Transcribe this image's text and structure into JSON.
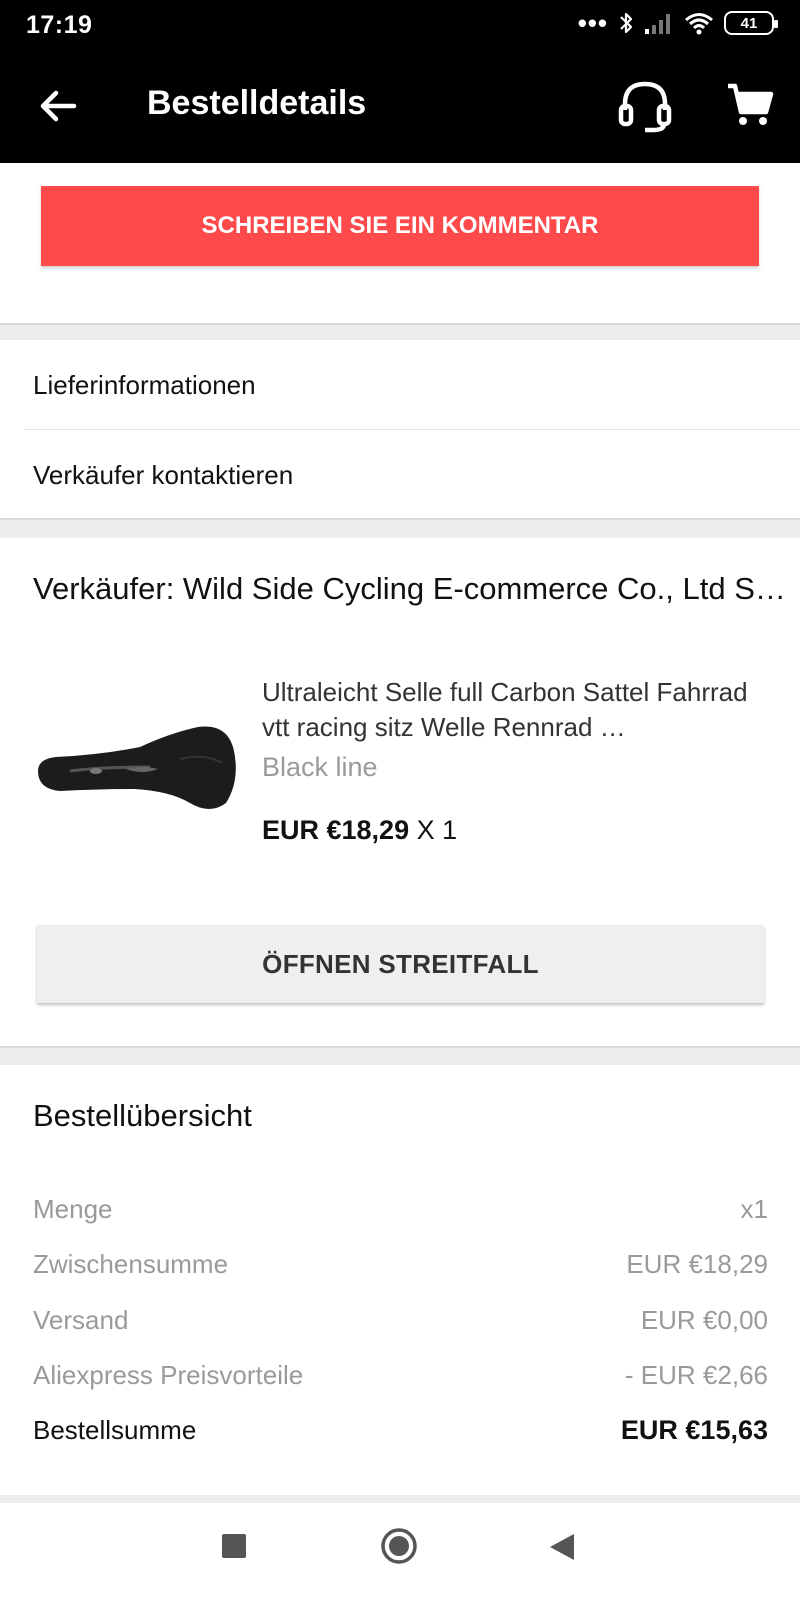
{
  "status_bar": {
    "time": "17:19",
    "signal_dots": "•••",
    "battery": "41"
  },
  "app_bar": {
    "title": "Bestelldetails",
    "icons": [
      "arrow-back-icon",
      "headset-support-icon",
      "shopping-cart-icon"
    ]
  },
  "comment_button": {
    "label": "SCHREIBEN SIE EIN KOMMENTAR",
    "color": "#fe4a4a"
  },
  "menu": {
    "delivery_info": "Lieferinformationen",
    "contact_seller": "Verkäufer kontaktieren"
  },
  "order": {
    "seller": "Verkäufer: Wild Side Cycling E-commerce Co., Ltd S…",
    "product": {
      "title": "Ultraleicht Selle full Carbon Sattel Fahrrad vtt racing sitz Welle Rennrad …",
      "variant": "Black line",
      "price": "EUR €18,29",
      "quantity": "X 1"
    },
    "dispute_button": "ÖFFNEN STREITFALL"
  },
  "summary": {
    "title": "Bestellübersicht",
    "rows": [
      {
        "label": "Menge",
        "value": "x1"
      },
      {
        "label": "Zwischensumme",
        "value": "EUR €18,29"
      },
      {
        "label": "Versand",
        "value": "EUR €0,00"
      },
      {
        "label": "Aliexpress Preisvorteile",
        "value": "- EUR €2,66"
      }
    ],
    "total": {
      "label": "Bestellsumme",
      "value": "EUR €15,63"
    }
  },
  "nav_bar": {
    "icons": [
      "recent-apps-icon",
      "home-icon",
      "back-icon"
    ]
  }
}
